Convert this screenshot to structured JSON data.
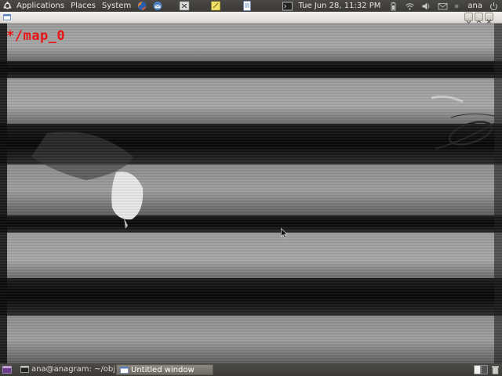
{
  "top_panel": {
    "menus": [
      "Applications",
      "Places",
      "System"
    ],
    "launchers": [
      "firefox-icon",
      "thunderbird-icon",
      "terminal-launcher-icon",
      "notes-icon",
      "text-editor-icon"
    ],
    "clock": "Tue Jun 28, 11:32 PM",
    "username": "ana",
    "tray_icons": [
      "terminal-icon",
      "battery-icon",
      "network-icon",
      "volume-icon",
      "mail-icon",
      "user-status-icon",
      "power-icon"
    ]
  },
  "window": {
    "title": "",
    "buttons": [
      "minimize-button",
      "maximize-button",
      "close-button"
    ]
  },
  "canvas": {
    "title": "*/map_0",
    "title_color": "#e81515"
  },
  "bottom_panel": {
    "tasks": [
      {
        "label": "ana@anagram: ~/objs...",
        "active": false
      },
      {
        "label": "Untitled window",
        "active": true
      }
    ]
  },
  "colors": {
    "panel_bg": "#3b3a36",
    "panel_text": "#dfdbd2",
    "titlebar_bg": "#dcdad5",
    "accent_red": "#e81515"
  }
}
